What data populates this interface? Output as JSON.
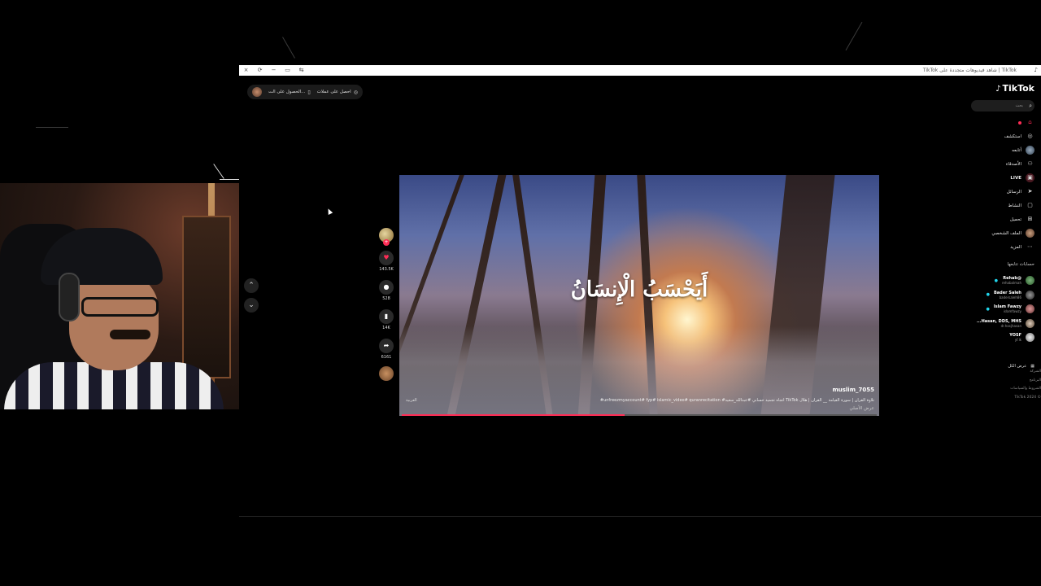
{
  "browser": {
    "tab_title": "TikTok | شاهد فيديوهات متجددة على TikTok",
    "controls": [
      "×",
      "⟳",
      "−",
      "▭",
      "⇆"
    ]
  },
  "topbar": {
    "get_coins": "احصل على عملات",
    "get_app": "الحصول على الت..."
  },
  "video": {
    "caption": "أَيَحْسَبُ الْإِنسَانُ",
    "author": "muslim_7055",
    "description": "تلاوة القرآن | سورة القيامة __ القرآن | هلال TikTok اتجاه تجميد حسابي #عبدالله_سعيد# unfreezmyaccount# fyp# islamic_video# quranrecitation#",
    "see_more": "عرض الأصلي",
    "language": "العربية",
    "progress_fraction": 0.47
  },
  "rail": {
    "likes": "143.5K",
    "comments": "528",
    "saves": "14K",
    "shares": "6161"
  },
  "sidebar": {
    "logo": "TikTok",
    "search_placeholder": "بحث",
    "nav": [
      {
        "label": "",
        "icon": "home-icon"
      },
      {
        "label": "استكشف",
        "icon": "compass-icon"
      },
      {
        "label": "أتابعه",
        "icon": "following-icon"
      },
      {
        "label": "الأصدقاء",
        "icon": "friends-icon"
      },
      {
        "label": "LIVE",
        "icon": "live-icon"
      },
      {
        "label": "الرسائل",
        "icon": "messages-icon"
      },
      {
        "label": "النشاط",
        "icon": "activity-icon"
      },
      {
        "label": "تحميل",
        "icon": "upload-icon"
      },
      {
        "label": "الملف الشخصي",
        "icon": "profile-icon"
      },
      {
        "label": "المزيد",
        "icon": "more-icon"
      }
    ],
    "following_title": "حسابات تتابعها",
    "following": [
      {
        "name": "Rehab@",
        "handle": "rehabalmah"
      },
      {
        "name": "Bader Saleh",
        "handle": "badersaleh86"
      },
      {
        "name": "Islam Fawzy",
        "handle": "islamfawzy"
      },
      {
        "name": "...Hasan, DDS, MHS",
        "handle": "dr.hasjhasan"
      },
      {
        "name": "YOSF",
        "handle": "yf.lk"
      }
    ],
    "see_all": "عرض الكل",
    "footer": [
      "الشركة",
      "البرنامج",
      "الشروط والسياسات",
      "© TikTok 2024"
    ]
  },
  "colors": {
    "accent": "#fe2c55",
    "verified": "#20d5ec",
    "background": "#000000"
  }
}
